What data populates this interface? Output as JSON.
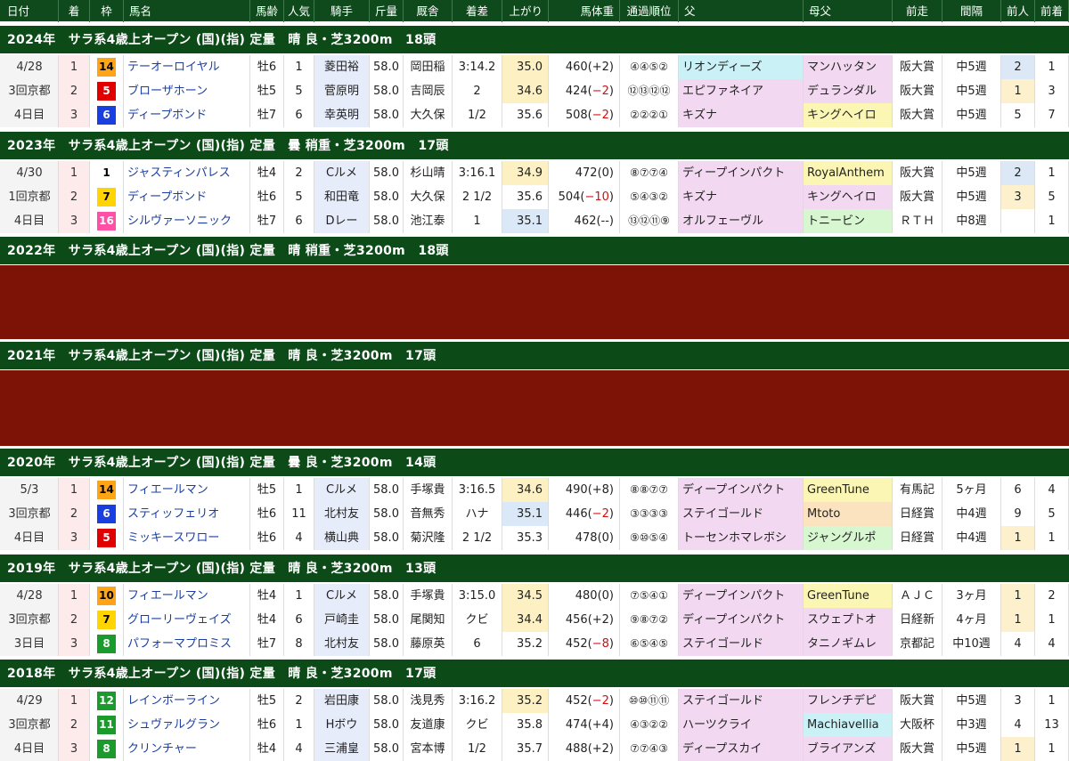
{
  "columns": [
    "日付",
    "着",
    "枠",
    "馬名",
    "馬齢",
    "人気",
    "騎手",
    "斤量",
    "厩舎",
    "着差",
    "上がり",
    "馬体重",
    "通過順位",
    "父",
    "母父",
    "前走",
    "間隔",
    "前人",
    "前着"
  ],
  "colors": {
    "header_green": "#0f4a1c",
    "banner_green": "#0c4a18",
    "void_red": "#7d1207",
    "rank_pink": "#fdeaea",
    "jockey_blue": "#e6ecfa",
    "last3_yellow": "#fdf1c4",
    "last3_blue": "#dbe8f8",
    "sire_pink": "#f3d8f1",
    "sire_cyan": "#c9f1f6",
    "bms_yellow": "#fbf6b3",
    "bms_green": "#d6f7cf",
    "bms_orange": "#fce3c0",
    "prevpop_blue": "#dde8f7",
    "prevpop_yellow": "#fcf0cd",
    "name_blue": "#1b3fa0"
  },
  "gate_colors": {
    "1": {
      "bg": "#ffffff",
      "fg": "#000000"
    },
    "5": {
      "bg": "#e00000",
      "fg": "#ffffff"
    },
    "6": {
      "bg": "#1a3fe0",
      "fg": "#ffffff"
    },
    "7": {
      "bg": "#ffd400",
      "fg": "#000000"
    },
    "8": {
      "bg": "#1b9b2c",
      "fg": "#ffffff"
    },
    "10": {
      "bg": "#ffa515",
      "fg": "#000000"
    },
    "11": {
      "bg": "#1b9b2c",
      "fg": "#ffffff"
    },
    "12": {
      "bg": "#1b9b2c",
      "fg": "#ffffff"
    },
    "14": {
      "bg": "#ffa515",
      "fg": "#000000"
    },
    "16": {
      "bg": "#ff4fa6",
      "fg": "#ffffff"
    }
  },
  "races": [
    {
      "banner": "2024年　サラ系4歳上オープン (国)(指) 定量　晴 良・芝3200m　18頭",
      "date": "4/28",
      "meet": "3回京都",
      "day": "4日目",
      "rows": [
        {
          "rank": "1",
          "gate": "14",
          "name": "テーオーロイヤル",
          "age": "牡6",
          "pop": "1",
          "jockey": "菱田裕",
          "weight": "58.0",
          "stable": "岡田稲",
          "margin": "3:14.2",
          "last3": "35.0",
          "last3c": "yellow",
          "body": "460(+2)",
          "pass": "④④⑤②",
          "sire": "リオンディーズ",
          "sirec": "cyan",
          "bms": "マンハッタン",
          "bmsc": "pink",
          "prev": "阪大賞",
          "interval": "中5週",
          "prevpop": "2",
          "prevpopc": "blue",
          "prevrank": "1"
        },
        {
          "rank": "2",
          "gate": "5",
          "name": "ブローザホーン",
          "age": "牡5",
          "pop": "5",
          "jockey": "菅原明",
          "weight": "58.0",
          "stable": "吉岡辰",
          "margin": "2",
          "last3": "34.6",
          "last3c": "yellow",
          "body": "424(−2)",
          "pass": "⑫⑬⑫⑫",
          "sire": "エピファネイア",
          "sirec": "pink",
          "bms": "デュランダル",
          "bmsc": "pink",
          "prev": "阪大賞",
          "interval": "中5週",
          "prevpop": "1",
          "prevpopc": "yellow",
          "prevrank": "3"
        },
        {
          "rank": "3",
          "gate": "6",
          "name": "ディープボンド",
          "age": "牡7",
          "pop": "6",
          "jockey": "幸英明",
          "weight": "58.0",
          "stable": "大久保",
          "margin": "1/2",
          "last3": "35.6",
          "last3c": "",
          "body": "508(−2)",
          "pass": "②②②①",
          "sire": "キズナ",
          "sirec": "pink",
          "bms": "キングヘイロ",
          "bmsc": "yellow",
          "prev": "阪大賞",
          "interval": "中5週",
          "prevpop": "5",
          "prevpopc": "",
          "prevrank": "7"
        }
      ]
    },
    {
      "banner": "2023年　サラ系4歳上オープン (国)(指) 定量　曇 稍重・芝3200m　17頭",
      "date": "4/30",
      "meet": "1回京都",
      "day": "4日目",
      "rows": [
        {
          "rank": "1",
          "gate": "1",
          "name": "ジャスティンパレス",
          "age": "牡4",
          "pop": "2",
          "jockey": "Cルメ",
          "weight": "58.0",
          "stable": "杉山晴",
          "margin": "3:16.1",
          "last3": "34.9",
          "last3c": "yellow",
          "body": "472(0)",
          "pass": "⑧⑦⑦④",
          "sire": "ディープインパクト",
          "sirec": "pink",
          "bms": "RoyalAnthem",
          "bmsc": "yellow",
          "prev": "阪大賞",
          "interval": "中5週",
          "prevpop": "2",
          "prevpopc": "blue",
          "prevrank": "1"
        },
        {
          "rank": "2",
          "gate": "7",
          "name": "ディープボンド",
          "age": "牡6",
          "pop": "5",
          "jockey": "和田竜",
          "weight": "58.0",
          "stable": "大久保",
          "margin": "2 1/2",
          "last3": "35.6",
          "last3c": "",
          "body": "504(−10)",
          "pass": "⑤④③②",
          "sire": "キズナ",
          "sirec": "pink",
          "bms": "キングヘイロ",
          "bmsc": "pink",
          "prev": "阪大賞",
          "interval": "中5週",
          "prevpop": "3",
          "prevpopc": "yellow",
          "prevrank": "5"
        },
        {
          "rank": "3",
          "gate": "16",
          "name": "シルヴァーソニック",
          "age": "牡7",
          "pop": "6",
          "jockey": "Dレー",
          "weight": "58.0",
          "stable": "池江泰",
          "margin": "1",
          "last3": "35.1",
          "last3c": "blue",
          "body": "462(--)",
          "pass": "⑬⑫⑪⑨",
          "sire": "オルフェーヴル",
          "sirec": "pink",
          "bms": "トニービン",
          "bmsc": "green",
          "prev": "ＲＴＨ",
          "interval": "中8週",
          "prevpop": "",
          "prevpopc": "",
          "prevrank": "1"
        }
      ]
    }
  ],
  "voids": [
    {
      "banner": "2022年　サラ系4歳上オープン (国)(指) 定量　晴 稍重・芝3200m　18頭"
    },
    {
      "banner": "2021年　サラ系4歳上オープン (国)(指) 定量　晴 良・芝3200m　17頭"
    }
  ],
  "races2": [
    {
      "banner": "2020年　サラ系4歳上オープン (国)(指) 定量　曇 良・芝3200m　14頭",
      "date": "5/3",
      "meet": "3回京都",
      "day": "4日目",
      "rows": [
        {
          "rank": "1",
          "gate": "14",
          "name": "フィエールマン",
          "age": "牡5",
          "pop": "1",
          "jockey": "Cルメ",
          "weight": "58.0",
          "stable": "手塚貴",
          "margin": "3:16.5",
          "last3": "34.6",
          "last3c": "yellow",
          "body": "490(+8)",
          "pass": "⑧⑧⑦⑦",
          "sire": "ディープインパクト",
          "sirec": "pink",
          "bms": "GreenTune",
          "bmsc": "yellow",
          "prev": "有馬記",
          "interval": "5ヶ月",
          "prevpop": "6",
          "prevpopc": "",
          "prevrank": "4"
        },
        {
          "rank": "2",
          "gate": "6",
          "name": "スティッフェリオ",
          "age": "牡6",
          "pop": "11",
          "jockey": "北村友",
          "weight": "58.0",
          "stable": "音無秀",
          "margin": "ハナ",
          "last3": "35.1",
          "last3c": "blue",
          "body": "446(−2)",
          "pass": "③③③③",
          "sire": "ステイゴールド",
          "sirec": "pink",
          "bms": "Mtoto",
          "bmsc": "orange",
          "prev": "日経賞",
          "interval": "中4週",
          "prevpop": "9",
          "prevpopc": "",
          "prevrank": "5"
        },
        {
          "rank": "3",
          "gate": "5",
          "name": "ミッキースワロー",
          "age": "牡6",
          "pop": "4",
          "jockey": "横山典",
          "weight": "58.0",
          "stable": "菊沢隆",
          "margin": "2 1/2",
          "last3": "35.3",
          "last3c": "",
          "body": "478(0)",
          "pass": "⑨⑩⑤④",
          "sire": "トーセンホマレボシ",
          "sirec": "pink",
          "bms": "ジャングルポ",
          "bmsc": "green",
          "prev": "日経賞",
          "interval": "中4週",
          "prevpop": "1",
          "prevpopc": "yellow",
          "prevrank": "1"
        }
      ]
    },
    {
      "banner": "2019年　サラ系4歳上オープン (国)(指) 定量　晴 良・芝3200m　13頭",
      "date": "4/28",
      "meet": "3回京都",
      "day": "3日目",
      "rows": [
        {
          "rank": "1",
          "gate": "10",
          "name": "フィエールマン",
          "age": "牡4",
          "pop": "1",
          "jockey": "Cルメ",
          "weight": "58.0",
          "stable": "手塚貴",
          "margin": "3:15.0",
          "last3": "34.5",
          "last3c": "yellow",
          "body": "480(0)",
          "pass": "⑦⑤④①",
          "sire": "ディープインパクト",
          "sirec": "pink",
          "bms": "GreenTune",
          "bmsc": "yellow",
          "prev": "ＡＪＣ",
          "interval": "3ヶ月",
          "prevpop": "1",
          "prevpopc": "yellow",
          "prevrank": "2"
        },
        {
          "rank": "2",
          "gate": "7",
          "name": "グローリーヴェイズ",
          "age": "牡4",
          "pop": "6",
          "jockey": "戸崎圭",
          "weight": "58.0",
          "stable": "尾関知",
          "margin": "クビ",
          "last3": "34.4",
          "last3c": "yellow",
          "body": "456(+2)",
          "pass": "⑨⑧⑦②",
          "sire": "ディープインパクト",
          "sirec": "pink",
          "bms": "スウェプトオ",
          "bmsc": "pink",
          "prev": "日経新",
          "interval": "4ヶ月",
          "prevpop": "1",
          "prevpopc": "yellow",
          "prevrank": "1"
        },
        {
          "rank": "3",
          "gate": "8",
          "name": "パフォーマプロミス",
          "age": "牡7",
          "pop": "8",
          "jockey": "北村友",
          "weight": "58.0",
          "stable": "藤原英",
          "margin": "6",
          "last3": "35.2",
          "last3c": "",
          "body": "452(−8)",
          "pass": "⑥⑤④⑤",
          "sire": "ステイゴールド",
          "sirec": "pink",
          "bms": "タニノギムレ",
          "bmsc": "pink",
          "prev": "京都記",
          "interval": "中10週",
          "prevpop": "4",
          "prevpopc": "",
          "prevrank": "4"
        }
      ]
    },
    {
      "banner": "2018年　サラ系4歳上オープン (国)(指) 定量　晴 良・芝3200m　17頭",
      "date": "4/29",
      "meet": "3回京都",
      "day": "4日目",
      "rows": [
        {
          "rank": "1",
          "gate": "12",
          "name": "レインボーライン",
          "age": "牡5",
          "pop": "2",
          "jockey": "岩田康",
          "weight": "58.0",
          "stable": "浅見秀",
          "margin": "3:16.2",
          "last3": "35.2",
          "last3c": "yellow",
          "body": "452(−2)",
          "pass": "⑩⑩⑪⑪",
          "sire": "ステイゴールド",
          "sirec": "pink",
          "bms": "フレンチデピ",
          "bmsc": "pink",
          "prev": "阪大賞",
          "interval": "中5週",
          "prevpop": "3",
          "prevpopc": "",
          "prevrank": "1"
        },
        {
          "rank": "2",
          "gate": "11",
          "name": "シュヴァルグラン",
          "age": "牡6",
          "pop": "1",
          "jockey": "Hボウ",
          "weight": "58.0",
          "stable": "友道康",
          "margin": "クビ",
          "last3": "35.8",
          "last3c": "",
          "body": "474(+4)",
          "pass": "④③②②",
          "sire": "ハーツクライ",
          "sirec": "pink",
          "bms": "Machiavellia",
          "bmsc": "cyan",
          "prev": "大阪杯",
          "interval": "中3週",
          "prevpop": "4",
          "prevpopc": "",
          "prevrank": "13"
        },
        {
          "rank": "3",
          "gate": "8",
          "name": "クリンチャー",
          "age": "牡4",
          "pop": "4",
          "jockey": "三浦皇",
          "weight": "58.0",
          "stable": "宮本博",
          "margin": "1/2",
          "last3": "35.7",
          "last3c": "",
          "body": "488(+2)",
          "pass": "⑦⑦④③",
          "sire": "ディープスカイ",
          "sirec": "pink",
          "bms": "ブライアンズ",
          "bmsc": "pink",
          "prev": "阪大賞",
          "interval": "中5週",
          "prevpop": "1",
          "prevpopc": "yellow",
          "prevrank": "1"
        }
      ]
    }
  ]
}
